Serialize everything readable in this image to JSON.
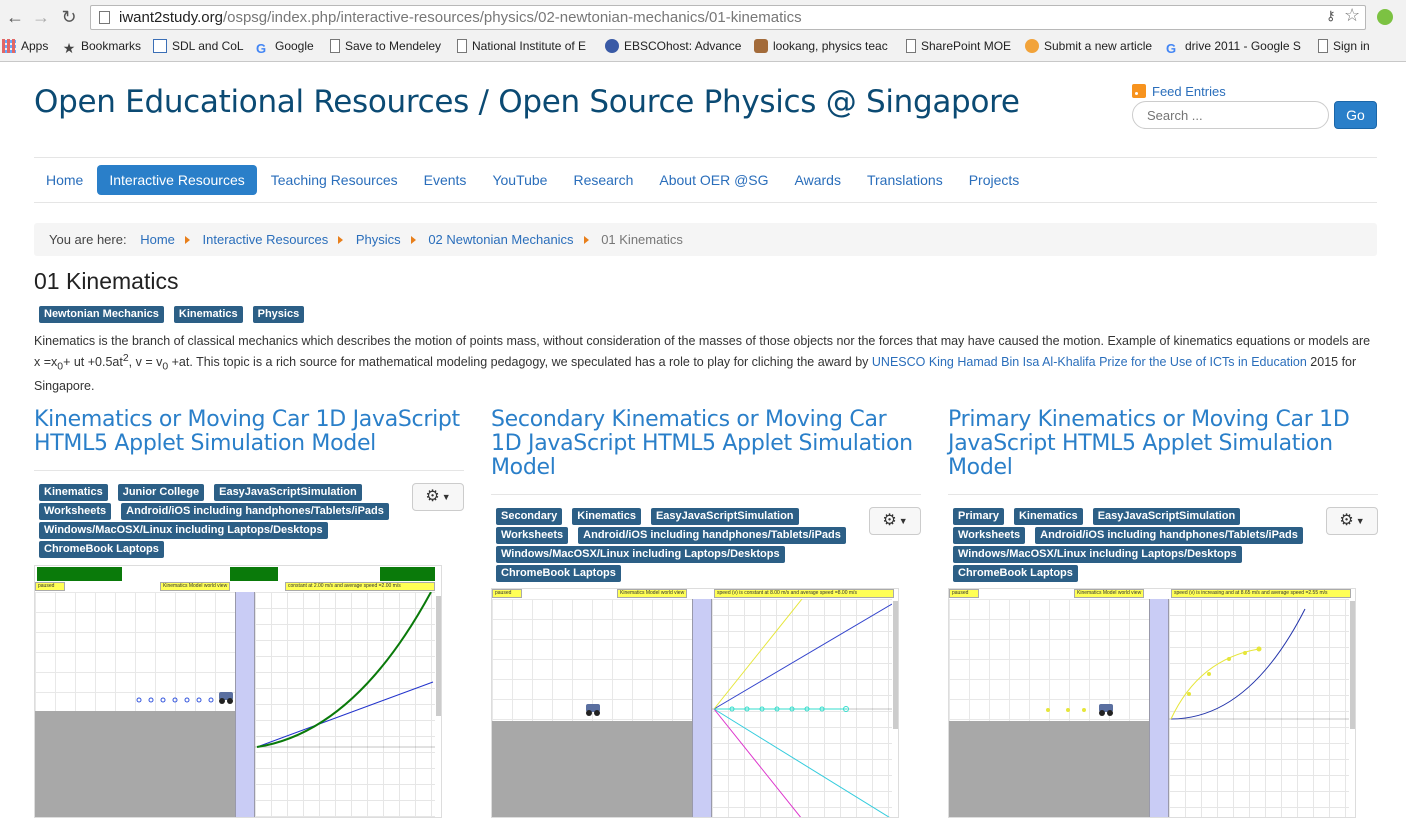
{
  "browser": {
    "url_host": "iwant2study.org",
    "url_path": "/ospsg/index.php/interactive-resources/physics/02-newtonian-mechanics/01-kinematics",
    "bookmarks": [
      "Apps",
      "Bookmarks",
      "SDL and CoL",
      "Google",
      "Save to Mendeley",
      "National Institute of E",
      "EBSCOhost: Advanced",
      "lookang, physics teac",
      "SharePoint MOE",
      "Submit a new article",
      "drive 2011 - Google S",
      "Sign in"
    ]
  },
  "header": {
    "site_title": "Open Educational Resources / Open Source Physics @ Singapore",
    "feed_label": "Feed Entries",
    "search_placeholder": "Search ...",
    "go_label": "Go"
  },
  "menu": [
    "Home",
    "Interactive Resources",
    "Teaching Resources",
    "Events",
    "YouTube",
    "Research",
    "About OER @SG",
    "Awards",
    "Translations",
    "Projects"
  ],
  "breadcrumb": {
    "label": "You are here:",
    "links": [
      "Home",
      "Interactive Resources",
      "Physics",
      "02 Newtonian Mechanics"
    ],
    "current": "01 Kinematics"
  },
  "page": {
    "title": "01 Kinematics",
    "tags": [
      "Newtonian Mechanics",
      "Kinematics",
      "Physics"
    ],
    "intro_part1": "Kinematics is the branch of classical mechanics which describes the motion of points mass, without consideration of the masses of those objects nor the forces that may have caused the motion. Example of kinematics equations or models are x =x",
    "intro_sub0": "0",
    "intro_part2": "+ ut +0.5at",
    "intro_sup2": "2",
    "intro_part3": ", v = v",
    "intro_part4": " +at. This topic is a rich source for mathematical modeling pedagogy, we speculated has a role to play for cliching the award by ",
    "intro_link": "UNESCO King Hamad Bin Isa Al-Khalifa Prize for the Use of ICTs in Education",
    "intro_part5": " 2015 for Singapore."
  },
  "articles": [
    {
      "title": "Kinematics or Moving Car 1D JavaScript HTML5 Applet Simulation Model",
      "tags": [
        "Kinematics",
        "Junior College",
        "EasyJavaScriptSimulation",
        "Worksheets",
        "Android/iOS including handphones/Tablets/iPads",
        "Windows/MacOSX/Linux including Laptops/Desktops",
        "ChromeBook Laptops"
      ],
      "applet_status": "paused",
      "applet_view": "Kinematics Model world view",
      "applet_graph_label": "constant at 2.00 m/s and average speed =2.00 m/s"
    },
    {
      "title": "Secondary Kinematics or Moving Car 1D JavaScript HTML5 Applet Simulation Model",
      "tags": [
        "Secondary",
        "Kinematics",
        "EasyJavaScriptSimulation",
        "Worksheets",
        "Android/iOS including handphones/Tablets/iPads",
        "Windows/MacOSX/Linux including Laptops/Desktops",
        "ChromeBook Laptops"
      ],
      "applet_status": "paused",
      "applet_view": "Kinematics Model world view",
      "applet_graph_label": "speed (v) is constant at 8.00 m/s and average speed =8.00 m/s"
    },
    {
      "title": "Primary Kinematics or Moving Car 1D JavaScript HTML5 Applet Simulation Model",
      "tags": [
        "Primary",
        "Kinematics",
        "EasyJavaScriptSimulation",
        "Worksheets",
        "Android/iOS including handphones/Tablets/iPads",
        "Windows/MacOSX/Linux including Laptops/Desktops",
        "ChromeBook Laptops"
      ],
      "applet_status": "paused",
      "applet_view": "Kinematics Model world view",
      "applet_graph_label": "speed (v) is increasing and at 8.65 m/s and average speed =2.55 m/s"
    }
  ],
  "colors": {
    "link": "#2a6ebb",
    "accent": "#2a7fc9",
    "title": "#0b4a73",
    "tag": "#2c5f86",
    "breadcrumb_sep": "#e87f1b"
  }
}
